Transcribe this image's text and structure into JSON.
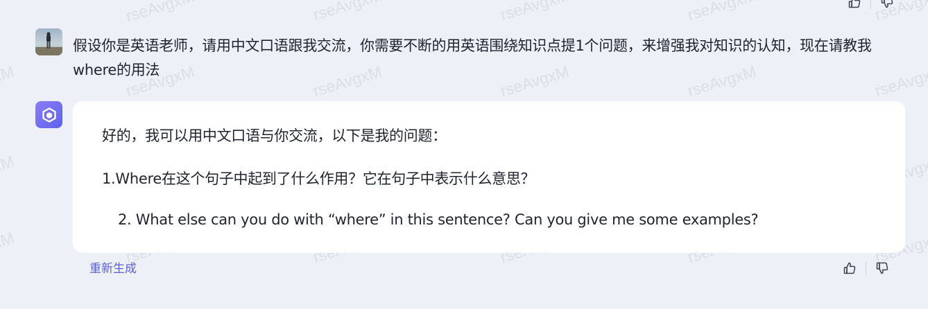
{
  "watermark": "rseAvgxM",
  "user_message": {
    "text": "假设你是英语老师，请用中文口语跟我交流，你需要不断的用英语围绕知识点提1个问题，来增强我对知识的认知，现在请教我where的用法"
  },
  "assistant_message": {
    "lines": [
      "好的，我可以用中文口语与你交流，以下是我的问题：",
      "1.Where在这个句子中起到了什么作用？它在句子中表示什么意思？",
      "2. What else can you do with “where” in this sentence? Can you give me some examples?"
    ]
  },
  "actions": {
    "regenerate_label": "重新生成",
    "like_icon": "thumbs-up-icon",
    "dislike_icon": "thumbs-down-icon"
  },
  "colors": {
    "background": "#eef0f7",
    "card": "#ffffff",
    "accent": "#5b5fd6",
    "bot_avatar_gradient": [
      "#8a7cf5",
      "#5d63ec"
    ]
  }
}
